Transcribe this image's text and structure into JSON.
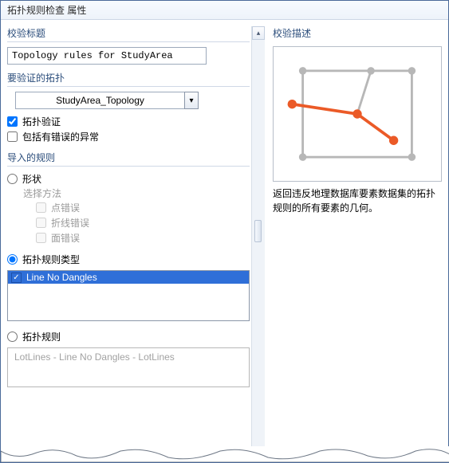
{
  "window": {
    "title": "拓扑规则检查 属性"
  },
  "left": {
    "validateTitle": {
      "label": "校验标题",
      "value": "Topology rules for StudyArea"
    },
    "topoToValidate": {
      "label": "要验证的拓扑",
      "selected": "StudyArea_Topology",
      "validateLabel": "拓扑验证",
      "validateChecked": true,
      "includeErrorsLabel": "包括有错误的异常",
      "includeErrorsChecked": false
    },
    "importedRules": {
      "label": "导入的规则",
      "shape": {
        "label": "形状",
        "selected": false,
        "methodLabel": "选择方法",
        "options": [
          {
            "label": "点错误",
            "checked": false
          },
          {
            "label": "折线错误",
            "checked": false
          },
          {
            "label": "面错误",
            "checked": false
          }
        ]
      },
      "ruleType": {
        "label": "拓扑规则类型",
        "selected": true,
        "items": [
          {
            "label": "Line No Dangles",
            "checked": true,
            "selected": true
          }
        ]
      },
      "rule": {
        "label": "拓扑规则",
        "selected": false,
        "placeholder": "LotLines - Line No Dangles - LotLines"
      }
    }
  },
  "right": {
    "descLabel": "校验描述",
    "descText": "返回违反地理数据库要素数据集的拓扑规则的所有要素的几何。"
  },
  "colors": {
    "accent": "#2f6fd8",
    "dangle": "#eb5a27",
    "grey": "#b7b7b7"
  }
}
